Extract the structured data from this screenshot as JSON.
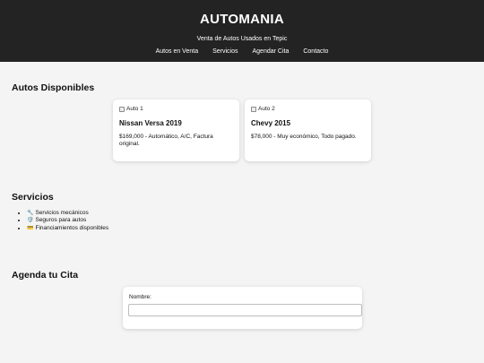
{
  "header": {
    "title": "AUTOMANIA",
    "subtitle": "Venta de Autos Usados en Tepic",
    "bg_color": "#232323",
    "nav": [
      {
        "label": "Autos en Venta"
      },
      {
        "label": "Servicios"
      },
      {
        "label": "Agendar Cita"
      },
      {
        "label": "Contacto"
      }
    ]
  },
  "autos": {
    "title": "Autos Disponibles",
    "cards": [
      {
        "img_alt": "Auto 1",
        "name": "Nissan Versa 2019",
        "desc": "$169,000 - Automático, A/C, Factura original."
      },
      {
        "img_alt": "Auto 2",
        "name": "Chevy 2015",
        "desc": "$78,000 - Muy económico, Todo pagado."
      }
    ]
  },
  "servicios": {
    "title": "Servicios",
    "items": [
      {
        "icon": "wrench-icon",
        "emoji": "🔧",
        "label": "Servicios mecánicos"
      },
      {
        "icon": "shield-icon",
        "emoji": "🛡️",
        "label": "Seguros para autos"
      },
      {
        "icon": "credit-card-icon",
        "emoji": "💳",
        "label": "Financiamientos disponibles"
      }
    ]
  },
  "cita": {
    "title": "Agenda tu Cita",
    "name_label": "Nombre:",
    "name_value": ""
  }
}
